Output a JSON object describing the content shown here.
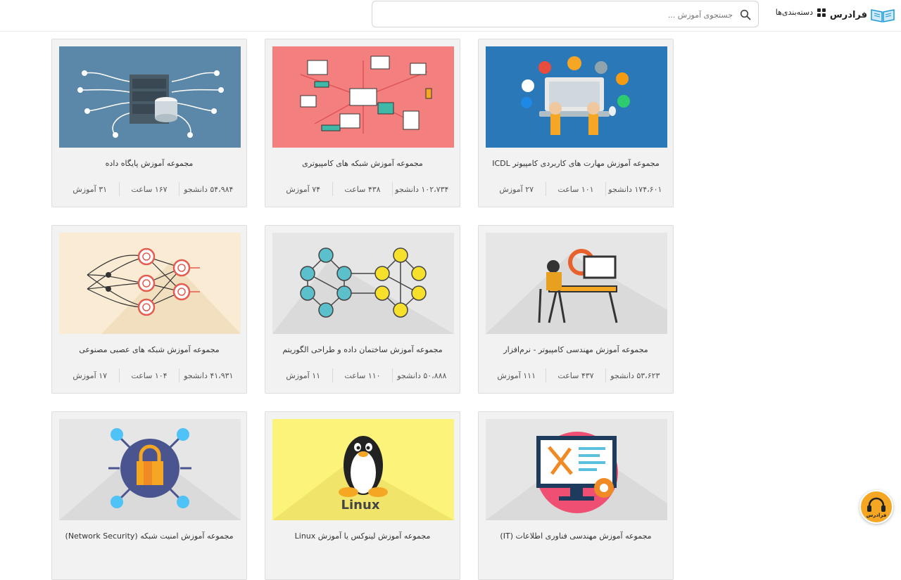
{
  "header": {
    "logo_text": "فرادرس",
    "categories_label": "دسته‌بندی‌ها",
    "search_placeholder": "جستجوی آموزش ..."
  },
  "cards": [
    {
      "title": "مجموعه آموزش مهارت های کاربردی کامپیوتر ICDL",
      "lessons": "۲۷ آموزش",
      "hours": "۱۰۱ ساعت",
      "students": "۱۷۴،۶۰۱ دانشجو"
    },
    {
      "title": "مجموعه آموزش شبکه های کامپیوتری",
      "lessons": "۷۴ آموزش",
      "hours": "۴۳۸ ساعت",
      "students": "۱۰۲،۷۳۴ دانشجو"
    },
    {
      "title": "مجموعه آموزش پایگاه داده",
      "lessons": "۳۱ آموزش",
      "hours": "۱۶۷ ساعت",
      "students": "۵۴،۹۸۴ دانشجو"
    },
    {
      "title": "مجموعه آموزش مهندسی کامپیوتر - نرم‌افزار",
      "lessons": "۱۱۱ آموزش",
      "hours": "۴۳۷ ساعت",
      "students": "۵۳،۶۲۳ دانشجو"
    },
    {
      "title": "مجموعه آموزش ساختمان داده و طراحی الگوریتم",
      "lessons": "۱۱ آموزش",
      "hours": "۱۱۰ ساعت",
      "students": "۵۰،۸۸۸ دانشجو"
    },
    {
      "title": "مجموعه آموزش شبکه های عصبی مصنوعی",
      "lessons": "۱۷ آموزش",
      "hours": "۱۰۴ ساعت",
      "students": "۴۱،۹۳۱ دانشجو"
    },
    {
      "title": "مجموعه آموزش مهندسی فناوری اطلاعات (IT)",
      "lessons": "",
      "hours": "",
      "students": ""
    },
    {
      "title": "مجموعه آموزش لینوکس یا آموزش Linux",
      "lessons": "",
      "hours": "",
      "students": ""
    },
    {
      "title": "مجموعه آموزش امنیت شبکه (Network Security)",
      "lessons": "",
      "hours": "",
      "students": ""
    }
  ],
  "linux_label": "Linux",
  "support": {
    "label": "فرادرس"
  },
  "colors": {
    "accent": "#1a9ad6",
    "support": "#f5a623",
    "card_bg": "#f2f2f2"
  }
}
